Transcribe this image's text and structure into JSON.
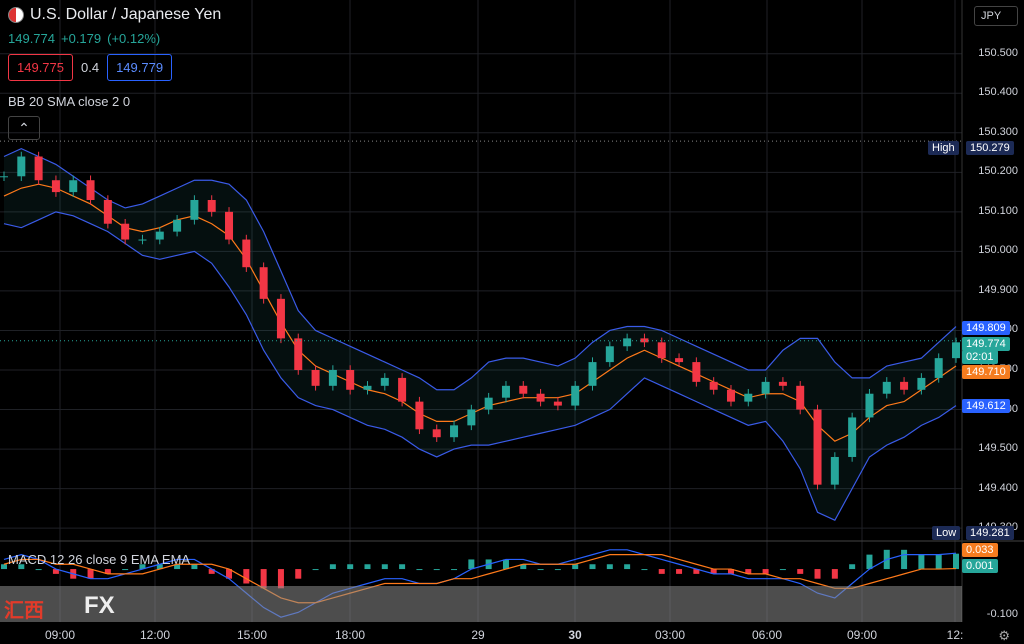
{
  "header": {
    "title": "U.S. Dollar / Japanese Yen",
    "last": "149.774",
    "change": "+0.179",
    "change_pct": "(+0.12%)"
  },
  "bidask": {
    "bid": "149.775",
    "spread": "0.4",
    "ask": "149.779"
  },
  "indicators": {
    "bb_label": "BB 20 SMA close 2 0",
    "macd_label": "MACD 12 26 close 9 EMA EMA"
  },
  "currency": "JPY",
  "price_axis": [
    "150.500",
    "150.400",
    "150.300",
    "150.200",
    "150.100",
    "150.000",
    "149.900",
    "149.800",
    "149.700",
    "149.600",
    "149.500",
    "149.400",
    "149.300"
  ],
  "tags": {
    "high_label": "High",
    "high": "150.279",
    "upper": "149.809",
    "last": "149.774",
    "countdown": "02:01",
    "middle": "149.710",
    "lower": "149.612",
    "low_label": "Low",
    "low": "149.281"
  },
  "macd_axis": {
    "macd": "0.033",
    "signal": "0.001",
    "bottom": "-0.100"
  },
  "time_axis": [
    "09:00",
    "12:00",
    "15:00",
    "18:00",
    "29",
    "30",
    "03:00",
    "06:00",
    "09:00",
    "12:"
  ],
  "watermark": {
    "cn": "汇西",
    "fx": "FX"
  },
  "colors": {
    "up": "#26a69a",
    "down": "#f23645",
    "band": "#3a5be8",
    "basis": "#ff7a1a",
    "bg": "#000000"
  },
  "icons": {
    "collapse": "chevron-up-icon",
    "settings": "gear-icon",
    "flag": "us-flag-icon"
  },
  "chart_data": {
    "type": "line",
    "series": [
      {
        "name": "close",
        "values": [
          150.19,
          150.24,
          150.18,
          150.15,
          150.18,
          150.13,
          150.07,
          150.03,
          150.03,
          150.05,
          150.08,
          150.13,
          150.1,
          150.03,
          149.96,
          149.88,
          149.78,
          149.7,
          149.66,
          149.7,
          149.65,
          149.66,
          149.68,
          149.62,
          149.55,
          149.53,
          149.56,
          149.6,
          149.63,
          149.66,
          149.64,
          149.62,
          149.61,
          149.66,
          149.72,
          149.76,
          149.78,
          149.77,
          149.73,
          149.72,
          149.67,
          149.65,
          149.62,
          149.64,
          149.67,
          149.66,
          149.6,
          149.41,
          149.48,
          149.58,
          149.64,
          149.67,
          149.65,
          149.68,
          149.73,
          149.77
        ]
      },
      {
        "name": "basis",
        "values": [
          150.14,
          150.16,
          150.17,
          150.16,
          150.14,
          150.12,
          150.09,
          150.06,
          150.05,
          150.06,
          150.08,
          150.09,
          150.07,
          150.04,
          149.98,
          149.9,
          149.82,
          149.75,
          149.71,
          149.69,
          149.67,
          149.65,
          149.64,
          149.62,
          149.59,
          149.57,
          149.57,
          149.59,
          149.61,
          149.62,
          149.63,
          149.63,
          149.63,
          149.64,
          149.67,
          149.7,
          149.73,
          149.75,
          149.73,
          149.71,
          149.69,
          149.67,
          149.65,
          149.63,
          149.64,
          149.64,
          149.62,
          149.56,
          149.52,
          149.54,
          149.58,
          149.61,
          149.62,
          149.65,
          149.68,
          149.71
        ]
      },
      {
        "name": "upper",
        "values": [
          150.24,
          150.26,
          150.24,
          150.22,
          150.19,
          150.16,
          150.13,
          150.11,
          150.12,
          150.14,
          150.16,
          150.18,
          150.18,
          150.17,
          150.13,
          150.05,
          149.95,
          149.85,
          149.8,
          149.78,
          149.76,
          149.74,
          149.72,
          149.7,
          149.68,
          149.65,
          149.65,
          149.68,
          149.72,
          149.73,
          149.73,
          149.72,
          149.71,
          149.73,
          149.77,
          149.8,
          149.81,
          149.81,
          149.8,
          149.78,
          149.76,
          149.74,
          149.72,
          149.7,
          149.7,
          149.75,
          149.78,
          149.78,
          149.72,
          149.68,
          149.68,
          149.71,
          149.72,
          149.73,
          149.77,
          149.81
        ]
      },
      {
        "name": "lower",
        "values": [
          150.07,
          150.06,
          150.08,
          150.1,
          150.09,
          150.07,
          150.05,
          150.02,
          149.99,
          149.98,
          149.99,
          150.0,
          149.97,
          149.91,
          149.84,
          149.75,
          149.68,
          149.63,
          149.61,
          149.6,
          149.58,
          149.56,
          149.55,
          149.53,
          149.5,
          149.48,
          149.5,
          149.51,
          149.51,
          149.52,
          149.53,
          149.54,
          149.55,
          149.56,
          149.58,
          149.6,
          149.64,
          149.68,
          149.66,
          149.64,
          149.62,
          149.6,
          149.58,
          149.56,
          149.57,
          149.52,
          149.45,
          149.34,
          149.32,
          149.4,
          149.48,
          149.51,
          149.53,
          149.56,
          149.58,
          149.61
        ]
      }
    ],
    "ylim": [
      149.27,
      150.56
    ],
    "macd": {
      "macd": [
        0.02,
        0.03,
        0.02,
        0.0,
        -0.01,
        -0.02,
        -0.02,
        -0.01,
        0.0,
        0.01,
        0.02,
        0.02,
        0.0,
        -0.02,
        -0.05,
        -0.08,
        -0.1,
        -0.09,
        -0.07,
        -0.05,
        -0.04,
        -0.03,
        -0.02,
        -0.02,
        -0.03,
        -0.03,
        -0.02,
        0.0,
        0.01,
        0.02,
        0.02,
        0.01,
        0.01,
        0.02,
        0.03,
        0.04,
        0.04,
        0.03,
        0.02,
        0.01,
        0.0,
        -0.01,
        -0.01,
        -0.02,
        -0.02,
        -0.02,
        -0.03,
        -0.05,
        -0.06,
        -0.03,
        0.0,
        0.02,
        0.03,
        0.03,
        0.03,
        0.033
      ],
      "signal": [
        0.01,
        0.02,
        0.02,
        0.01,
        0.01,
        0.0,
        -0.01,
        -0.01,
        -0.01,
        0.0,
        0.01,
        0.01,
        0.01,
        0.0,
        -0.02,
        -0.04,
        -0.06,
        -0.07,
        -0.07,
        -0.06,
        -0.05,
        -0.04,
        -0.03,
        -0.03,
        -0.03,
        -0.03,
        -0.02,
        -0.02,
        -0.01,
        0.0,
        0.01,
        0.01,
        0.01,
        0.01,
        0.02,
        0.03,
        0.03,
        0.03,
        0.03,
        0.02,
        0.01,
        0.0,
        0.0,
        -0.01,
        -0.01,
        -0.02,
        -0.02,
        -0.03,
        -0.04,
        -0.04,
        -0.03,
        -0.02,
        -0.01,
        0.0,
        0.0,
        0.001
      ],
      "ylim": [
        -0.11,
        0.05
      ]
    }
  }
}
